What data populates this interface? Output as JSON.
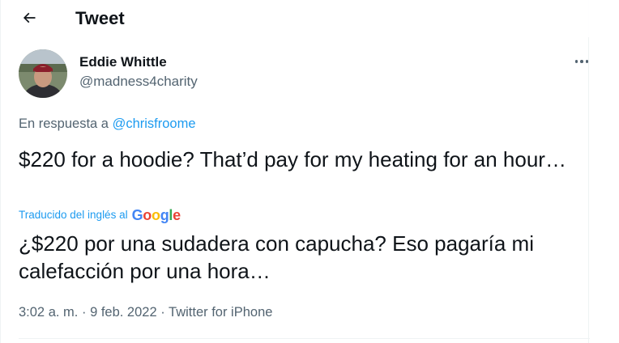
{
  "header": {
    "title": "Tweet",
    "back_icon": "arrow-left-icon"
  },
  "author": {
    "display_name": "Eddie Whittle",
    "handle": "@madness4charity",
    "avatar_icon": "user-avatar"
  },
  "more_icon": "more-horizontal-icon",
  "reply": {
    "prefix": "En respuesta a",
    "mention": "@chrisfroome"
  },
  "tweet": {
    "text": "$220 for a hoodie? That’d pay for my heating for an hour…",
    "translated_by": "Traducido del inglés al",
    "translator": "Google",
    "translation": "¿$220 por una sudadera con capucha? Eso pagaría mi calefacción por una hora…"
  },
  "meta": {
    "time": "3:02 a. m.",
    "separator": "·",
    "date": "9 feb. 2022",
    "source": "Twitter for iPhone"
  },
  "colors": {
    "accent": "#1d9bf0",
    "secondary_text": "#536471",
    "text": "#0f1419"
  }
}
